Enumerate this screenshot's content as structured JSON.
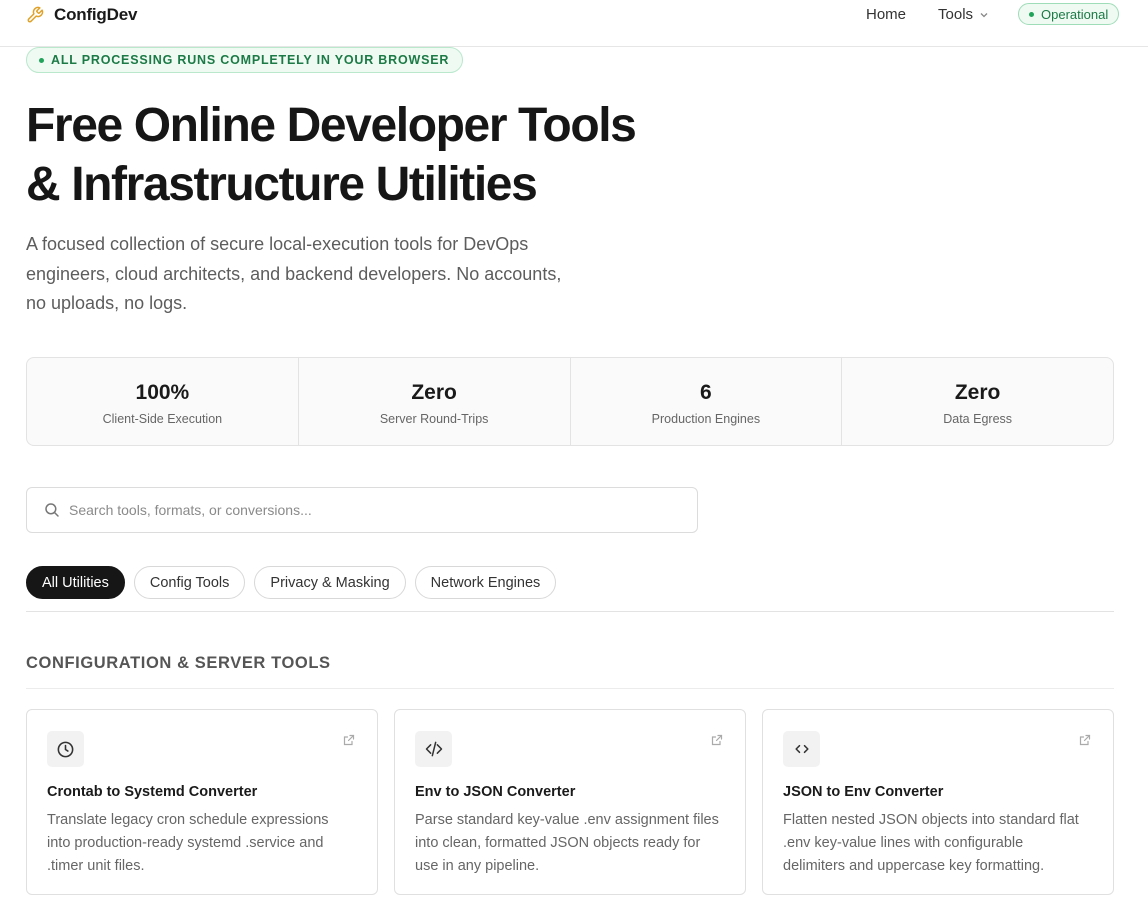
{
  "header": {
    "brand": "ConfigDev",
    "nav": {
      "home": "Home",
      "tools": "Tools"
    },
    "status": "Operational"
  },
  "hero": {
    "badge": "ALL PROCESSING RUNS COMPLETELY IN YOUR BROWSER",
    "title_line1": "Free Online Developer Tools",
    "title_line2": "& Infrastructure Utilities",
    "subtitle_line1": "A focused collection of secure local-execution tools for DevOps",
    "subtitle_line2": "engineers, cloud architects, and backend developers. No accounts,",
    "subtitle_line3": "no uploads, no logs."
  },
  "stats": [
    {
      "value": "100%",
      "label": "Client-Side Execution"
    },
    {
      "value": "Zero",
      "label": "Server Round-Trips"
    },
    {
      "value": "6",
      "label": "Production Engines"
    },
    {
      "value": "Zero",
      "label": "Data Egress"
    }
  ],
  "search": {
    "placeholder": "Search tools, formats, or conversions...",
    "value": ""
  },
  "filters": [
    {
      "label": "All Utilities",
      "active": true
    },
    {
      "label": "Config Tools",
      "active": false
    },
    {
      "label": "Privacy & Masking",
      "active": false
    },
    {
      "label": "Network Engines",
      "active": false
    }
  ],
  "section": {
    "title": "CONFIGURATION & SERVER TOOLS"
  },
  "cards": [
    {
      "icon": "clock-icon",
      "title": "Crontab to Systemd Converter",
      "desc_line1": "Translate legacy cron schedule expressions",
      "desc_line2": "into production-ready systemd .service and",
      "desc_line3": ".timer unit files."
    },
    {
      "icon": "code-icon",
      "title": "Env to JSON Converter",
      "desc_line1": "Parse standard key-value .env assignment files",
      "desc_line2": "into clean, formatted JSON objects ready for",
      "desc_line3": "use in any pipeline."
    },
    {
      "icon": "angle-brackets-icon",
      "title": "JSON to Env Converter",
      "desc_line1": "Flatten nested JSON objects into standard flat",
      "desc_line2": ".env key-value lines with configurable",
      "desc_line3": "delimiters and uppercase key formatting."
    }
  ],
  "colors": {
    "accent_green": "#22a35a",
    "active_chip": "#161616"
  }
}
